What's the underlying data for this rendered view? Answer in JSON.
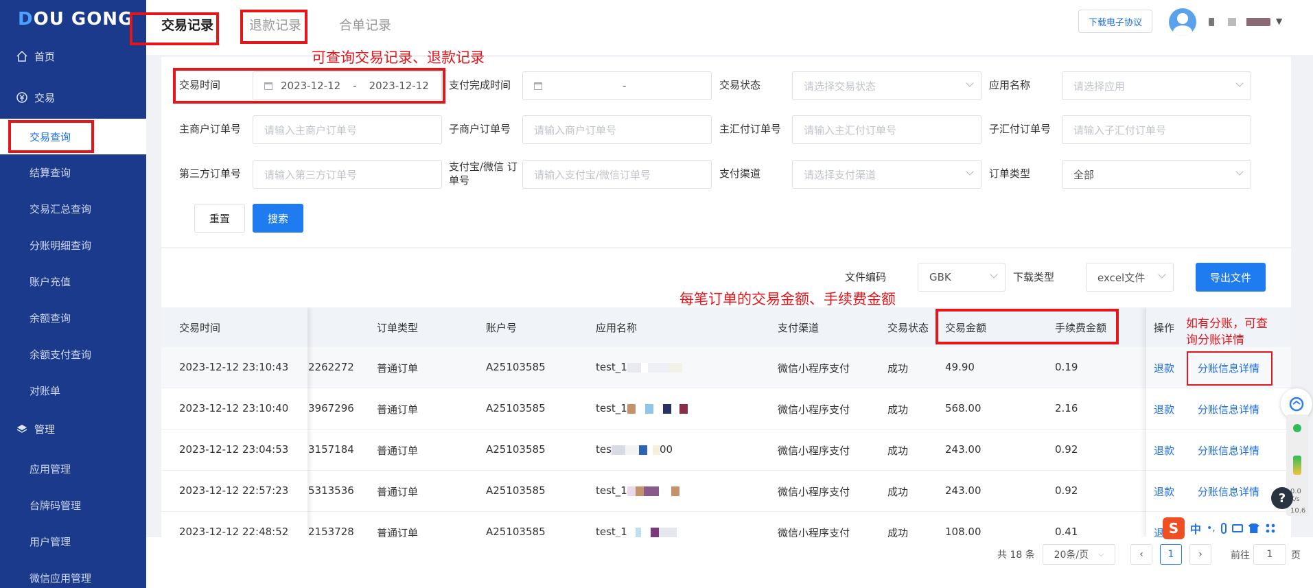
{
  "brand": {
    "logo_d": "D",
    "logo_rest": "OU GONG"
  },
  "sidebar": {
    "items": [
      {
        "label": "首页"
      },
      {
        "label": "交易"
      },
      {
        "label": "交易查询"
      },
      {
        "label": "结算查询"
      },
      {
        "label": "交易汇总查询"
      },
      {
        "label": "分账明细查询"
      },
      {
        "label": "账户充值"
      },
      {
        "label": "余额查询"
      },
      {
        "label": "余额支付查询"
      },
      {
        "label": "对账单"
      },
      {
        "label": "管理"
      },
      {
        "label": "应用管理"
      },
      {
        "label": "台牌码管理"
      },
      {
        "label": "用户管理"
      },
      {
        "label": "微信应用管理"
      }
    ]
  },
  "header": {
    "tabs": [
      {
        "label": "交易记录"
      },
      {
        "label": "退款记录"
      },
      {
        "label": "合单记录"
      }
    ],
    "download_agreement": "下载电子协议"
  },
  "filters": {
    "trade_time_label": "交易时间",
    "trade_time_start": "2023-12-12",
    "trade_time_sep": "-",
    "trade_time_end": "2023-12-12",
    "pay_done_time_label": "支付完成时间",
    "pay_done_sep": "-",
    "trade_status_label": "交易状态",
    "trade_status_placeholder": "请选择交易状态",
    "app_name_label": "应用名称",
    "app_name_placeholder": "请选择应用",
    "main_merchant_order_label": "主商户订单号",
    "main_merchant_order_placeholder": "请输入主商户订单号",
    "sub_merchant_order_label": "子商户订单号",
    "sub_merchant_order_placeholder": "请输入商户订单号",
    "main_remit_order_label": "主汇付订单号",
    "main_remit_order_placeholder": "请输入主汇付订单号",
    "sub_remit_order_label": "子汇付订单号",
    "sub_remit_order_placeholder": "请输入子汇付订单号",
    "third_party_order_label": "第三方订单号",
    "third_party_order_placeholder": "请输入第三方订单号",
    "alipay_wechat_order_label_1": "支付宝/微信 订",
    "alipay_wechat_order_label_2": "单号",
    "alipay_wechat_order_placeholder": "请输入支付宝/微信订单号",
    "pay_channel_label": "支付渠道",
    "pay_channel_placeholder": "请选择支付渠道",
    "order_type_label": "订单类型",
    "order_type_value": "全部",
    "reset_button": "重置",
    "search_button": "搜索"
  },
  "export": {
    "file_encoding_label": "文件编码",
    "file_encoding_value": "GBK",
    "download_type_label": "下载类型",
    "download_type_value": "excel文件",
    "export_button": "导出文件"
  },
  "table": {
    "columns": [
      "交易时间",
      "订单类型",
      "账户号",
      "应用名称",
      "支付渠道",
      "交易状态",
      "交易金额",
      "手续费金额",
      "操作"
    ],
    "rows": [
      {
        "time": "2023-12-12 23:10:43",
        "order_no": "2262272",
        "order_type": "普通订单",
        "account": "A25103585",
        "app": "test_1",
        "channel": "微信小程序支付",
        "status": "成功",
        "amount": "49.90",
        "fee": "0.19",
        "refund": "退款",
        "split": "分账信息详情"
      },
      {
        "time": "2023-12-12 23:10:40",
        "order_no": "3967296",
        "order_type": "普通订单",
        "account": "A25103585",
        "app": "test_1",
        "channel": "微信小程序支付",
        "status": "成功",
        "amount": "568.00",
        "fee": "2.16",
        "refund": "退款",
        "split": "分账信息详情"
      },
      {
        "time": "2023-12-12 23:04:53",
        "order_no": "3157184",
        "order_type": "普通订单",
        "account": "A25103585",
        "app": "tes",
        "app_tail": "00",
        "channel": "微信小程序支付",
        "status": "成功",
        "amount": "243.00",
        "fee": "0.92",
        "refund": "退款",
        "split": "分账信息详情"
      },
      {
        "time": "2023-12-12 22:57:23",
        "order_no": "5313536",
        "order_type": "普通订单",
        "account": "A25103585",
        "app": "test_1",
        "channel": "微信小程序支付",
        "status": "成功",
        "amount": "243.00",
        "fee": "0.92",
        "refund": "退款",
        "split": "分账信息详情"
      },
      {
        "time": "2023-12-12 22:48:52",
        "order_no": "2153728",
        "order_type": "普通订单",
        "account": "A25103585",
        "app": "test_1",
        "channel": "微信小程序支付",
        "status": "成功",
        "amount": "108.00",
        "fee": "0.41",
        "refund": "退",
        "split": ""
      }
    ]
  },
  "pagination": {
    "total": "共 18 条",
    "page_size": "20条/页",
    "current_page": "1",
    "goto_label": "前往",
    "goto_value": "1",
    "page_suffix": "页"
  },
  "annotations": {
    "tabs_note": "可查询交易记录、退款记录",
    "amount_note": "每笔订单的交易金额、手续费金额",
    "split_note": "如有分账，可查询分账详情"
  },
  "widgets": {
    "help": "?",
    "speed_1": "0.0",
    "speed_2": "K/s",
    "speed_3": "10.6",
    "ime_zh": "中",
    "ime_punct": "•,"
  },
  "colors": {
    "sidebar_bg": "#1b3a8c",
    "primary": "#1e7cf0",
    "annotation_red": "#e5151c",
    "link": "#1f6fe5"
  }
}
